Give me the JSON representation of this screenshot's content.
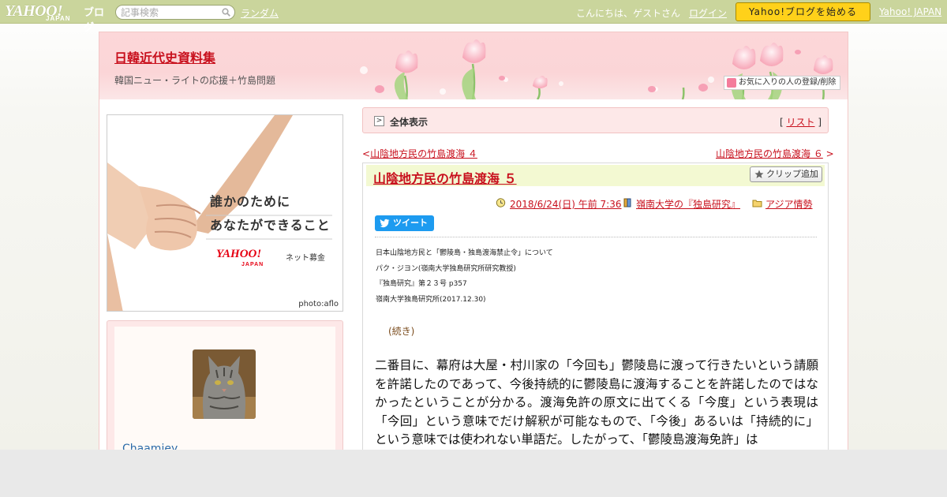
{
  "topbar": {
    "logo_text": "YAHOO!",
    "logo_sub": "JAPAN",
    "logo_blog": "ブログ",
    "search_placeholder": "記事検索",
    "random_label": "ランダム",
    "greeting": "こんにちは、ゲストさん",
    "login_label": "ログイン",
    "start_blog_label": "Yahoo!ブログを始める",
    "yahoo_japan_label": "Yahoo! JAPAN"
  },
  "blog": {
    "title": "日韓近代史資料集",
    "description": "韓国ニュー・ライトの応援＋竹島問題",
    "favorite_label": "お気に入りの人の登録/削除"
  },
  "ad": {
    "line1": "誰かのために",
    "line2": "あなたができること",
    "brand": "YAHOO!",
    "brand_sub": "JAPAN",
    "service": "ネット募金",
    "credit": "photo:aflo"
  },
  "profile": {
    "name": "Chaamiey"
  },
  "toolbar": {
    "show_all_label": "全体表示",
    "list_open": "[",
    "list_label": "リスト",
    "list_close": "]"
  },
  "nav": {
    "prev_arrow": "<",
    "prev_title": "山陰地方民の竹島渡海 ４",
    "next_title": "山陰地方民の竹島渡海 ６",
    "next_arrow": ">"
  },
  "article": {
    "title": "山陰地方民の竹島渡海 ５",
    "clip_label": "クリップ追加",
    "date": "2018/6/24(日) 午前 7:36",
    "category": "嶺南大学の『独島研究』",
    "folder": "アジア情勢",
    "tweet_label": "ツイート",
    "source_lines": [
      "日本山陰地方民と「鬱陵島・独島渡海禁止令」について",
      "パク・ジヨン(嶺南大学独島研究所研究教授)",
      "『独島研究』第２３号 p357",
      "嶺南大学独島研究所(2017.12.30)"
    ],
    "continued": "(続き)",
    "body": "二番目に、幕府は大屋・村川家の「今回も」鬱陵島に渡って行きたいという請願を許諾したのであって、今後持続的に鬱陵島に渡海することを許諾したのではなかったということが分かる。渡海免許の原文に出てくる「今度」という表現は「今回」という意味でだけ解釈が可能なもので、「今後」あるいは「持続的に」という意味では使われない単語だ。したがって、「鬱陵島渡海免許」は"
  },
  "colors": {
    "topbar_bg": "#cad59c",
    "link_red": "#c8101d",
    "header_pink": "#fcd7d9",
    "title_bar_green": "#f3f9d2",
    "start_button": "#ffd11a",
    "tweet_blue": "#1d9bf0"
  }
}
